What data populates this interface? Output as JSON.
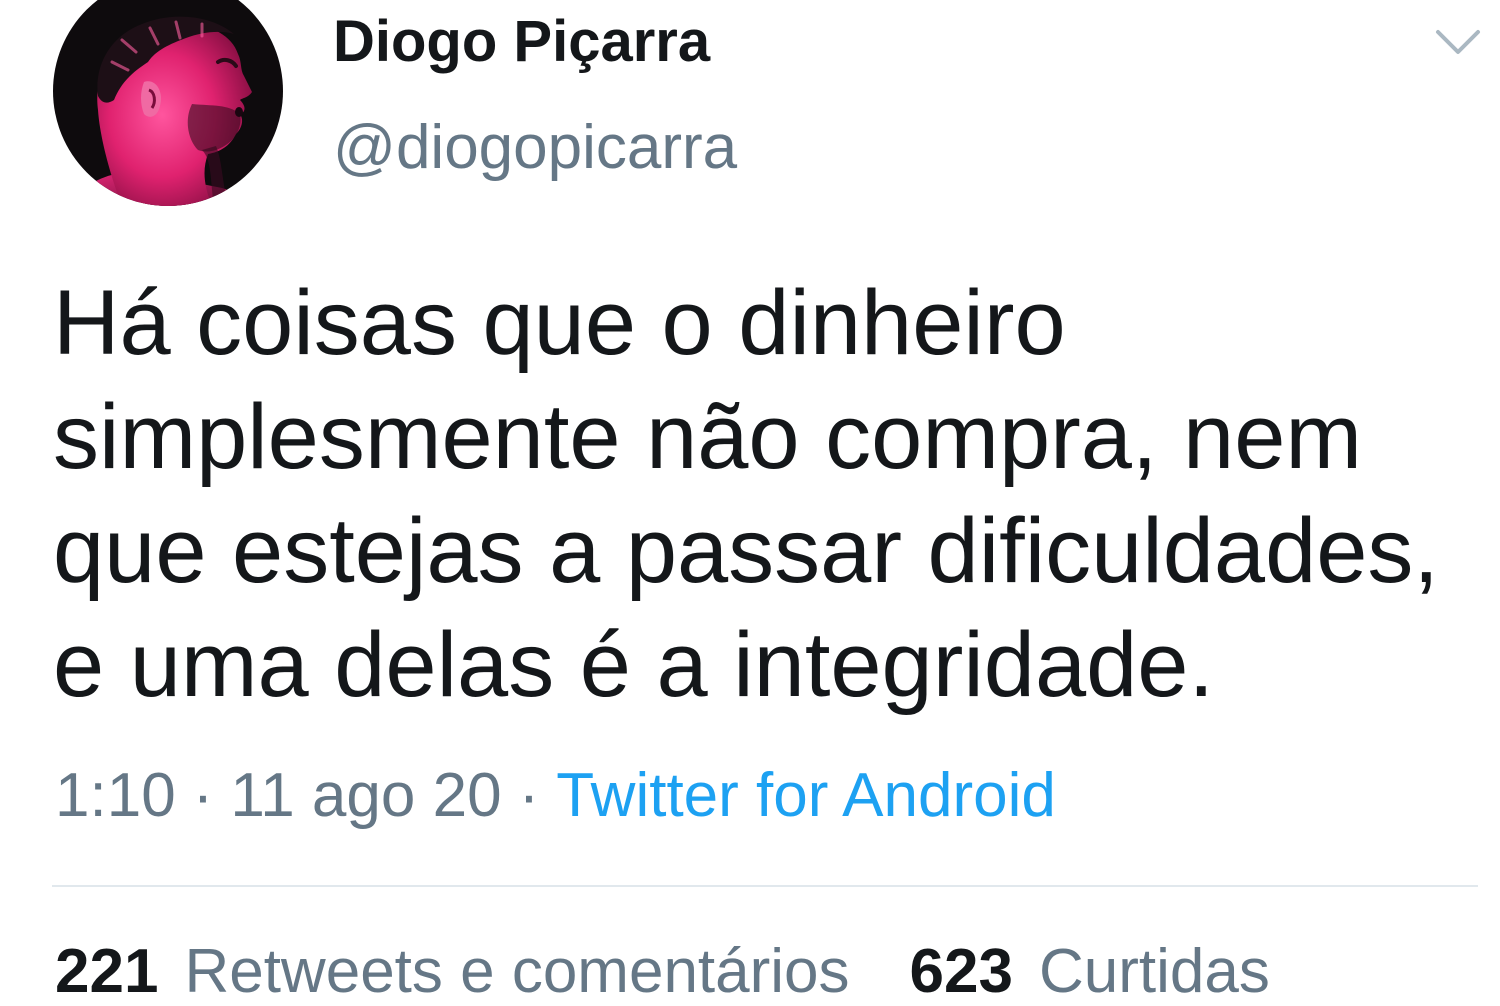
{
  "colors": {
    "background": "#ffffff",
    "text": "#14171a",
    "secondary": "#657786",
    "link": "#1da1f2",
    "divider": "#e1e8ed",
    "icon": "#aab8c2"
  },
  "author": {
    "name": "Diogo Piçarra",
    "handle": "@diogopicarra",
    "menu_icon": "chevron-down-icon"
  },
  "tweet": {
    "lines": [
      "Há coisas que o dinheiro",
      "simplesmente não compra, nem",
      "que estejas a passar dificuldades,",
      "e uma delas é a integridade."
    ]
  },
  "meta": {
    "time": "1:10",
    "separator": "·",
    "date": "11 ago 20",
    "source": "Twitter for Android"
  },
  "stats": {
    "retweets": {
      "count": "221",
      "label": "Retweets e comentários"
    },
    "likes": {
      "count": "623",
      "label": "Curtidas"
    }
  }
}
